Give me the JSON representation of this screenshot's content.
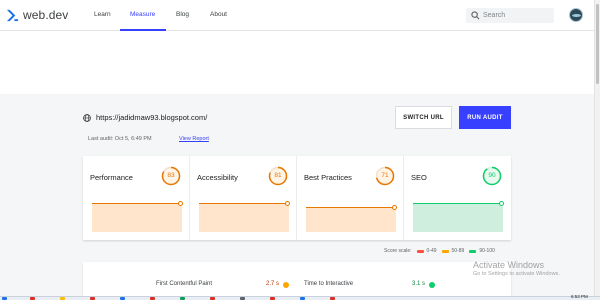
{
  "header": {
    "logo_text": "web.dev",
    "nav": [
      {
        "label": "Learn",
        "active": false
      },
      {
        "label": "Measure",
        "active": true
      },
      {
        "label": "Blog",
        "active": false
      },
      {
        "label": "About",
        "active": false
      }
    ],
    "search_placeholder": "Search",
    "logo_color": "#1a73e8",
    "active_color": "#3740ff"
  },
  "audit": {
    "url": "https://jadidmaw93.blogspot.com/",
    "last_audit": "Last audit: Oct 5, 6:49 PM",
    "view_report": "View Report",
    "switch_url_label": "SWITCH URL",
    "run_audit_label": "RUN AUDIT"
  },
  "scores": [
    {
      "label": "Performance",
      "score": "83",
      "status": "average",
      "color": "#e67700",
      "fill": "#ffe5cc"
    },
    {
      "label": "Accessibility",
      "score": "81",
      "status": "average",
      "color": "#e67700",
      "fill": "#ffe5cc"
    },
    {
      "label": "Best Practices",
      "score": "71",
      "status": "average",
      "color": "#e67700",
      "fill": "#ffe5cc"
    },
    {
      "label": "SEO",
      "score": "90",
      "status": "pass",
      "color": "#0cce6b",
      "fill": "#cfeedd"
    }
  ],
  "legend": {
    "title": "Score scale:",
    "items": [
      {
        "label": "0-49",
        "color": "#ff4e42"
      },
      {
        "label": "50-89",
        "color": "#ffa400"
      },
      {
        "label": "90-100",
        "color": "#0cce6b"
      }
    ]
  },
  "metrics": [
    {
      "label": "First Contentful Paint",
      "value": "2.7 s",
      "status": "average"
    },
    {
      "label": "Time to Interactive",
      "value": "3.1 s",
      "status": "pass"
    }
  ],
  "watermark": {
    "title": "Activate Windows",
    "subtitle": "Go to Settings to activate Windows."
  },
  "taskbar": {
    "time": "6:53 PM"
  }
}
